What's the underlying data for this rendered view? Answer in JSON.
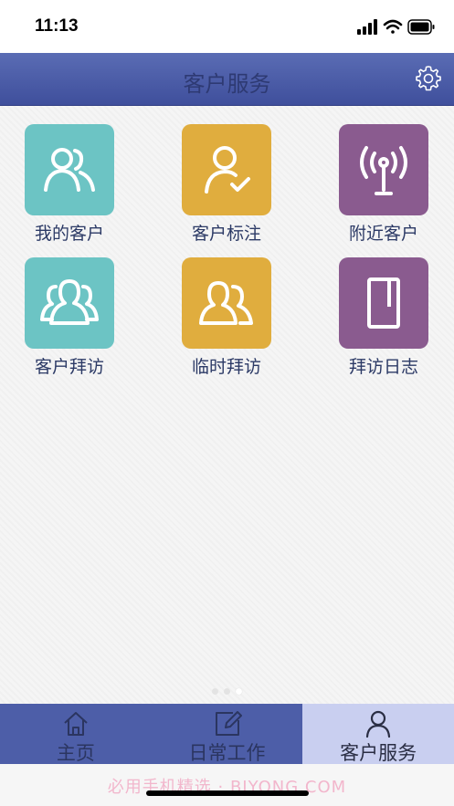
{
  "status_bar": {
    "time": "11:13"
  },
  "header": {
    "title": "客户服务",
    "settings_icon": "gear-icon"
  },
  "tiles": [
    {
      "label": "我的客户",
      "icon": "customers-icon",
      "color": "#6cc4c4"
    },
    {
      "label": "客户标注",
      "icon": "user-check-icon",
      "color": "#e0ad3e"
    },
    {
      "label": "附近客户",
      "icon": "signal-tower-icon",
      "color": "#8a5b8f"
    },
    {
      "label": "客户拜访",
      "icon": "group-icon",
      "color": "#6cc4c4"
    },
    {
      "label": "临时拜访",
      "icon": "users-icon",
      "color": "#e0ad3e"
    },
    {
      "label": "拜访日志",
      "icon": "notebook-icon",
      "color": "#8a5b8f"
    }
  ],
  "pager": {
    "count": 3,
    "active_index": 2
  },
  "tab_bar": {
    "tabs": [
      {
        "label": "主页",
        "icon": "home-icon",
        "active": false
      },
      {
        "label": "日常工作",
        "icon": "edit-icon",
        "active": false
      },
      {
        "label": "客户服务",
        "icon": "person-icon",
        "active": true
      }
    ],
    "background": "#4d5ea8",
    "active_background": "#c9cff0"
  },
  "watermark": "必用手机精选 · BIYONG.COM"
}
